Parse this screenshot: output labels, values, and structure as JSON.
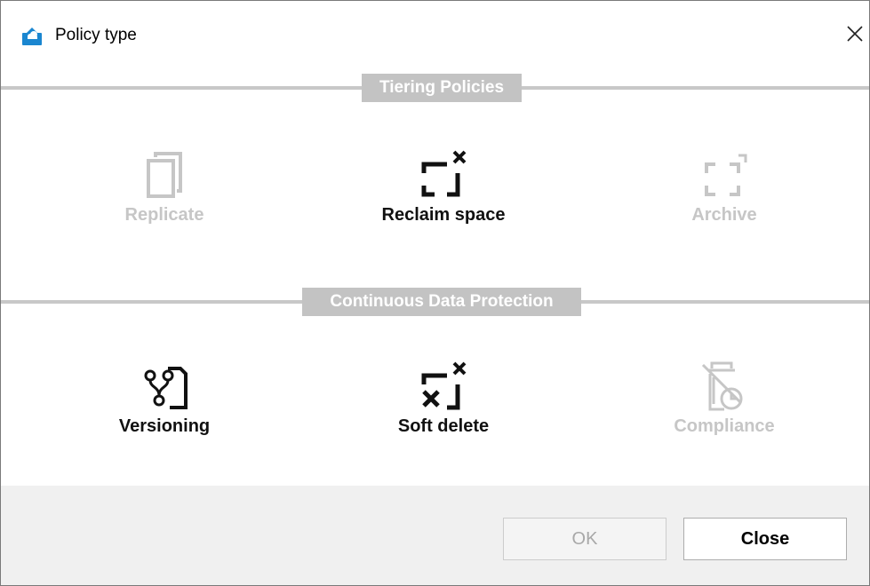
{
  "window": {
    "title": "Policy type",
    "close_glyph": "✕"
  },
  "sections": [
    {
      "label": "Tiering Policies",
      "tiles": [
        {
          "label": "Replicate",
          "icon": "replicate-icon",
          "enabled": false
        },
        {
          "label": "Reclaim space",
          "icon": "reclaim-space-icon",
          "enabled": true
        },
        {
          "label": "Archive",
          "icon": "archive-icon",
          "enabled": false
        }
      ]
    },
    {
      "label": "Continuous Data Protection",
      "tiles": [
        {
          "label": "Versioning",
          "icon": "versioning-icon",
          "enabled": true
        },
        {
          "label": "Soft delete",
          "icon": "soft-delete-icon",
          "enabled": true
        },
        {
          "label": "Compliance",
          "icon": "compliance-icon",
          "enabled": false
        }
      ]
    }
  ],
  "footer": {
    "ok_label": "OK",
    "close_label": "Close"
  },
  "colors": {
    "disabled": "#c6c6c6",
    "enabled": "#111111",
    "section_bg": "#c3c3c3",
    "footer_bg": "#f0f0f0",
    "app_icon": "#1a86d0"
  }
}
